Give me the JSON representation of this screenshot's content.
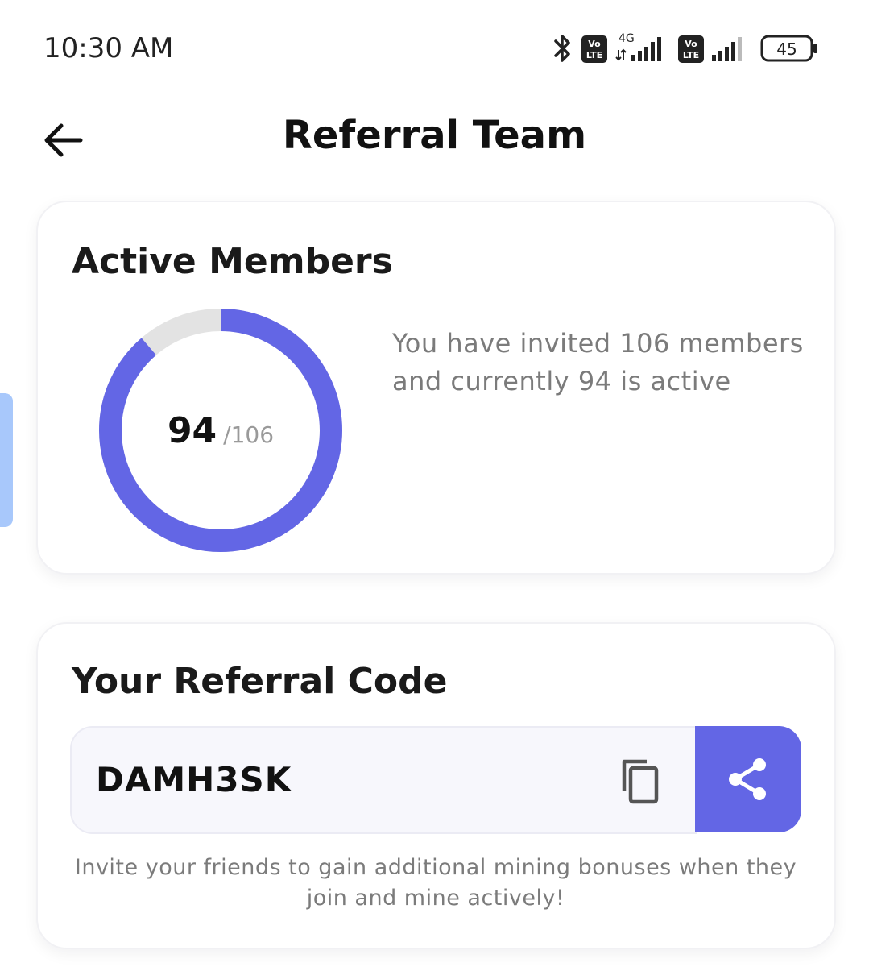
{
  "status_bar": {
    "time": "10:30 AM",
    "network_label": "4G",
    "volte_label_1": "Vo",
    "volte_label_2": "LTE",
    "battery_level": "45"
  },
  "header": {
    "title": "Referral Team"
  },
  "members_card": {
    "title": "Active Members",
    "active_count": "94",
    "total_label": "/106",
    "active_fraction": 0.8868,
    "description": "You have invited 106 members and currently 94 is active"
  },
  "referral_card": {
    "title": "Your Referral Code",
    "code": "DAMH3SK",
    "note": "Invite your friends to gain additional mining bonuses when they join and mine actively!"
  },
  "colors": {
    "accent": "#6366e5",
    "ring_track": "#e3e3e3"
  }
}
